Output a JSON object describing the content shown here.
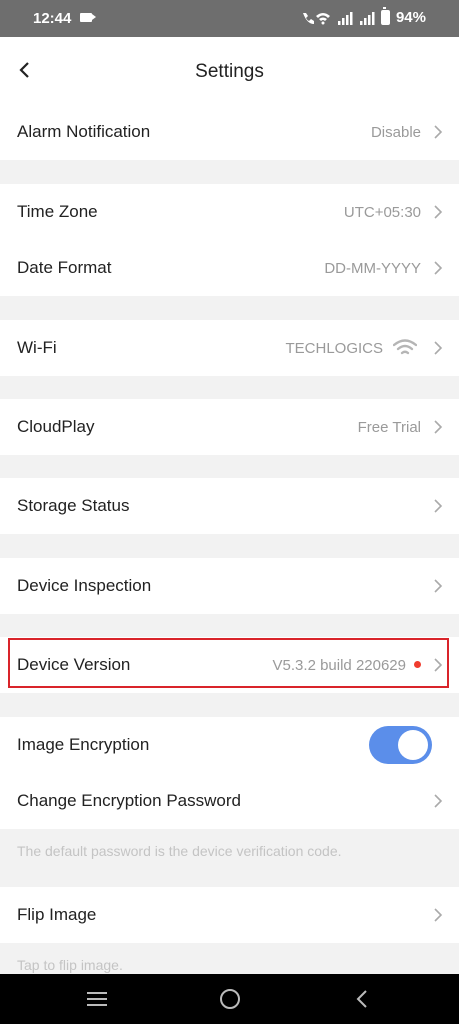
{
  "status_bar": {
    "time": "12:44",
    "battery": "94%"
  },
  "header": {
    "title": "Settings"
  },
  "rows": {
    "alarm": {
      "label": "Alarm Notification",
      "value": "Disable"
    },
    "timezone": {
      "label": "Time Zone",
      "value": "UTC+05:30"
    },
    "date_format": {
      "label": "Date Format",
      "value": "DD-MM-YYYY"
    },
    "wifi": {
      "label": "Wi-Fi",
      "value": "TECHLOGICS"
    },
    "cloudplay": {
      "label": "CloudPlay",
      "value": "Free Trial"
    },
    "storage": {
      "label": "Storage Status"
    },
    "inspection": {
      "label": "Device Inspection"
    },
    "version": {
      "label": "Device Version",
      "value": "V5.3.2 build 220629"
    },
    "encryption": {
      "label": "Image Encryption",
      "enabled": true
    },
    "change_password": {
      "label": "Change Encryption Password",
      "hint": "The default password is the device verification code."
    },
    "flip": {
      "label": "Flip Image",
      "hint": "Tap to flip image."
    }
  },
  "colors": {
    "accent": "#5b8eea",
    "highlight_border": "#d9242a",
    "update_dot": "#f03c2e"
  },
  "icons": [
    "back-arrow-icon",
    "chevron-right-icon",
    "wifi-icon",
    "menu-icon",
    "home-icon",
    "back-icon"
  ]
}
